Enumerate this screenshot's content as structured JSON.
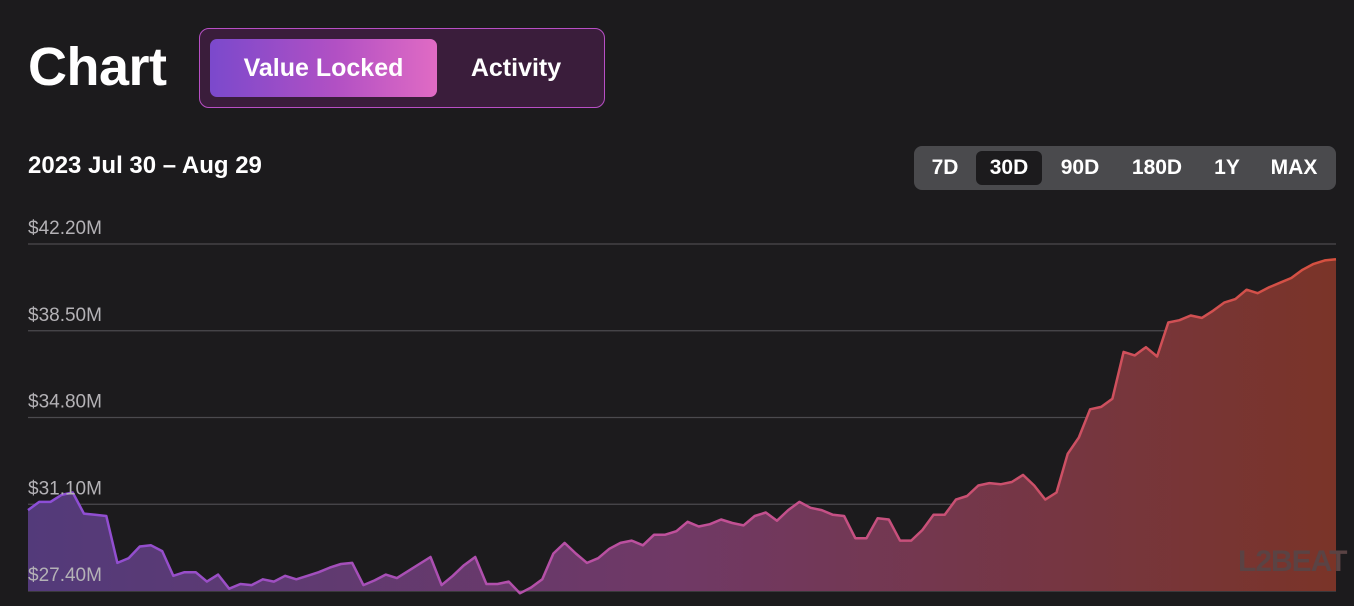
{
  "page": {
    "title": "Chart"
  },
  "toggle": {
    "options": [
      "Value Locked",
      "Activity"
    ],
    "selected": "Value Locked"
  },
  "date_range": "2023 Jul 30 – Aug 29",
  "periods": {
    "options": [
      "7D",
      "30D",
      "90D",
      "180D",
      "1Y",
      "MAX"
    ],
    "selected": "30D"
  },
  "watermark": "L2BEAT",
  "colors": {
    "line_start": "#8b4ed8",
    "line_mid": "#c0509a",
    "line_end": "#d6503e",
    "toggle_border": "#b84fc5"
  },
  "chart_data": {
    "type": "area",
    "title": "",
    "xlabel": "",
    "ylabel": "",
    "y_ticks": [
      "$27.40M",
      "$31.10M",
      "$34.80M",
      "$38.50M",
      "$42.20M"
    ],
    "ylim": [
      27.4,
      42.2
    ],
    "x": [
      "2023-07-30",
      "2023-08-29"
    ],
    "values": [
      30.85,
      31.2,
      31.2,
      31.5,
      31.6,
      30.7,
      30.65,
      30.6,
      28.6,
      28.8,
      29.3,
      29.35,
      29.1,
      28.05,
      28.2,
      28.2,
      27.8,
      28.1,
      27.5,
      27.7,
      27.65,
      27.9,
      27.8,
      28.05,
      27.9,
      28.05,
      28.2,
      28.4,
      28.55,
      28.6,
      27.65,
      27.85,
      28.1,
      27.95,
      28.25,
      28.55,
      28.85,
      27.65,
      28.05,
      28.5,
      28.85,
      27.7,
      27.7,
      27.8,
      27.3,
      27.55,
      27.9,
      29.0,
      29.45,
      29.0,
      28.6,
      28.8,
      29.2,
      29.45,
      29.55,
      29.35,
      29.8,
      29.8,
      29.95,
      30.35,
      30.15,
      30.25,
      30.45,
      30.3,
      30.2,
      30.6,
      30.75,
      30.4,
      30.85,
      31.2,
      30.95,
      30.85,
      30.65,
      30.6,
      29.65,
      29.65,
      30.5,
      30.45,
      29.55,
      29.55,
      30.0,
      30.65,
      30.65,
      31.3,
      31.45,
      31.9,
      32.0,
      31.95,
      32.05,
      32.35,
      31.9,
      31.3,
      31.6,
      33.25,
      33.95,
      35.15,
      35.25,
      35.6,
      37.6,
      37.45,
      37.8,
      37.4,
      38.85,
      38.95,
      39.15,
      39.05,
      39.35,
      39.7,
      39.85,
      40.25,
      40.1,
      40.35,
      40.55,
      40.75,
      41.1,
      41.35,
      41.5,
      41.55
    ]
  }
}
